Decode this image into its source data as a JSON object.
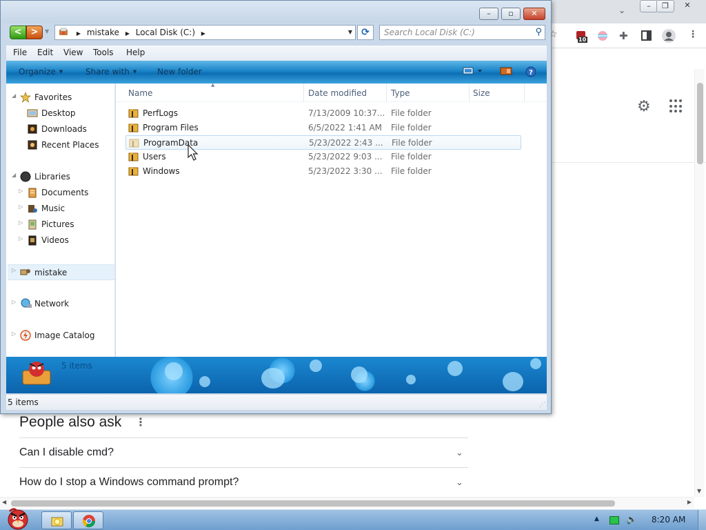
{
  "browser": {
    "google": {
      "people_also_ask": {
        "title": "People also ask",
        "more": "⋮",
        "questions": [
          "Can I disable cmd?",
          "How do I stop a Windows command prompt?"
        ]
      }
    },
    "extension_badge": "10"
  },
  "explorer": {
    "title_controls": {
      "minimize": "–",
      "maximize": "▫",
      "close": "✕"
    },
    "address": {
      "crumbs": [
        "mistake",
        "Local Disk (C:)"
      ]
    },
    "search": {
      "placeholder": "Search Local Disk (C:)"
    },
    "menu": [
      "File",
      "Edit",
      "View",
      "Tools",
      "Help"
    ],
    "commands": {
      "organize": "Organize",
      "share_with": "Share with",
      "new_folder": "New folder"
    },
    "nav": {
      "favorites": {
        "label": "Favorites",
        "items": [
          "Desktop",
          "Downloads",
          "Recent Places"
        ]
      },
      "libraries": {
        "label": "Libraries",
        "items": [
          "Documents",
          "Music",
          "Pictures",
          "Videos"
        ]
      },
      "homegroup": "mistake",
      "network": "Network",
      "image_catalog": "Image Catalog"
    },
    "columns": {
      "name": "Name",
      "date": "Date modified",
      "type": "Type",
      "size": "Size"
    },
    "files": [
      {
        "name": "PerfLogs",
        "date": "7/13/2009 10:37...",
        "type": "File folder"
      },
      {
        "name": "Program Files",
        "date": "6/5/2022 1:41 AM",
        "type": "File folder"
      },
      {
        "name": "ProgramData",
        "date": "5/23/2022 2:43 ...",
        "type": "File folder"
      },
      {
        "name": "Users",
        "date": "5/23/2022 9:03 ...",
        "type": "File folder"
      },
      {
        "name": "Windows",
        "date": "5/23/2022 3:30 ...",
        "type": "File folder"
      }
    ],
    "details_count": "5 items",
    "status": "5 items"
  },
  "taskbar": {
    "clock": "8:20 AM"
  },
  "colors": {
    "command_bar": "#1b84c8",
    "folder": "#e9b23a",
    "selection": "#e5f1fb"
  }
}
